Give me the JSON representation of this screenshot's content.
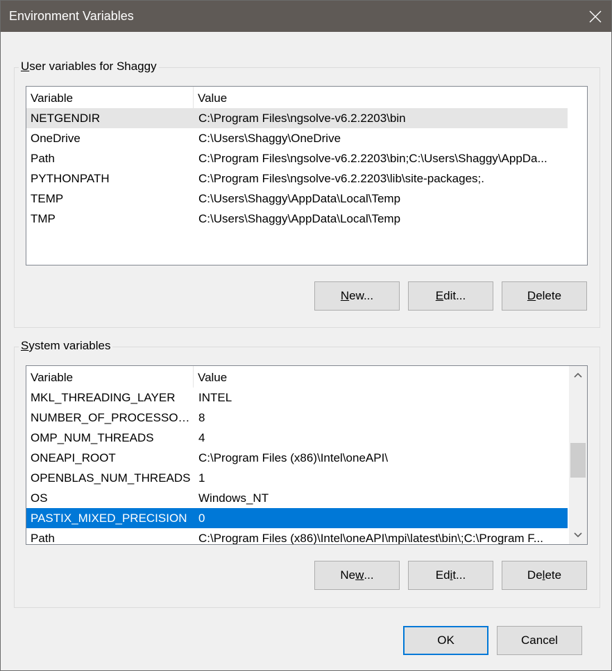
{
  "window": {
    "title": "Environment Variables",
    "titlebar_color": "#5f5a56",
    "accent": "#0078d7"
  },
  "user_section": {
    "title_prefix": "",
    "title_underlined": "U",
    "title_rest": "ser variables for Shaggy",
    "columns": [
      "Variable",
      "Value"
    ],
    "rows": [
      {
        "variable": "NETGENDIR",
        "value": "C:\\Program Files\\ngsolve-v6.2.2203\\bin",
        "state": "hover"
      },
      {
        "variable": "OneDrive",
        "value": "C:\\Users\\Shaggy\\OneDrive",
        "state": "normal"
      },
      {
        "variable": "Path",
        "value": "C:\\Program Files\\ngsolve-v6.2.2203\\bin;C:\\Users\\Shaggy\\AppDa...",
        "state": "normal"
      },
      {
        "variable": "PYTHONPATH",
        "value": "C:\\Program Files\\ngsolve-v6.2.2203\\lib\\site-packages;.",
        "state": "normal"
      },
      {
        "variable": "TEMP",
        "value": "C:\\Users\\Shaggy\\AppData\\Local\\Temp",
        "state": "normal"
      },
      {
        "variable": "TMP",
        "value": "C:\\Users\\Shaggy\\AppData\\Local\\Temp",
        "state": "normal"
      }
    ],
    "buttons": {
      "new": {
        "pre": "",
        "ul": "N",
        "post": "ew..."
      },
      "edit": {
        "pre": "",
        "ul": "E",
        "post": "dit..."
      },
      "delete": {
        "pre": "",
        "ul": "D",
        "post": "elete"
      }
    }
  },
  "system_section": {
    "title_prefix": "",
    "title_underlined": "S",
    "title_rest": "ystem variables",
    "columns": [
      "Variable",
      "Value"
    ],
    "rows": [
      {
        "variable": "MKL_THREADING_LAYER",
        "value": "INTEL",
        "state": "normal"
      },
      {
        "variable": "NUMBER_OF_PROCESSORS",
        "value": "8",
        "state": "normal"
      },
      {
        "variable": "OMP_NUM_THREADS",
        "value": "4",
        "state": "normal"
      },
      {
        "variable": "ONEAPI_ROOT",
        "value": "C:\\Program Files (x86)\\Intel\\oneAPI\\",
        "state": "normal"
      },
      {
        "variable": "OPENBLAS_NUM_THREADS",
        "value": "1",
        "state": "normal"
      },
      {
        "variable": "OS",
        "value": "Windows_NT",
        "state": "normal"
      },
      {
        "variable": "PASTIX_MIXED_PRECISION",
        "value": "0",
        "state": "selected"
      },
      {
        "variable": "Path",
        "value": "C:\\Program Files (x86)\\Intel\\oneAPI\\mpi\\latest\\bin\\;C:\\Program F...",
        "state": "normal"
      }
    ],
    "scrollbar_position": 0.55,
    "buttons": {
      "new": {
        "pre": "Ne",
        "ul": "w",
        "post": "..."
      },
      "edit": {
        "pre": "Ed",
        "ul": "i",
        "post": "t..."
      },
      "delete": {
        "pre": "De",
        "ul": "l",
        "post": "ete"
      }
    }
  },
  "footer": {
    "ok_label": "OK",
    "cancel_label": "Cancel"
  }
}
